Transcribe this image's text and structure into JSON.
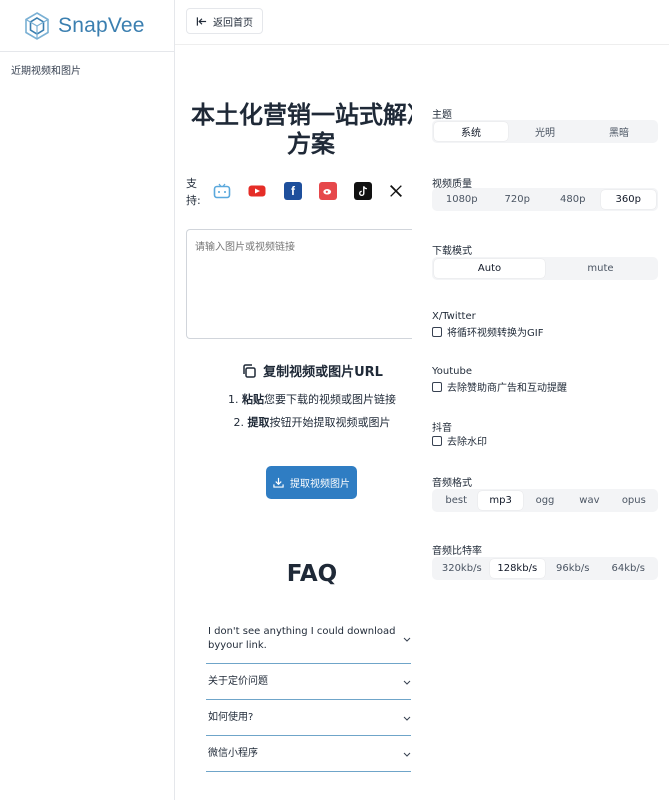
{
  "brand": {
    "name": "SnapVee",
    "color": "#3b7fb0"
  },
  "sidebar": {
    "recent_label": "近期视频和图片"
  },
  "topbar": {
    "back_label": "返回首页"
  },
  "hero": {
    "title": "本土化营销一站式解决方案",
    "support_label": "支持:",
    "platforms": [
      "bilibili-icon",
      "youtube-icon",
      "facebook-icon",
      "weibo-icon",
      "tiktok-icon",
      "x-icon"
    ],
    "input_placeholder": "请输入图片或视频链接",
    "copy_heading": "复制视频或图片URL",
    "steps": [
      {
        "num": "1.",
        "bold": "粘贴",
        "rest": "您要下载的视频或图片链接"
      },
      {
        "num": "2.",
        "bold": "提取",
        "rest": "按钮开始提取视频或图片"
      }
    ],
    "extract_label": "提取视频图片",
    "accent": "#2f7dc3"
  },
  "faq": {
    "title": "FAQ",
    "items": [
      "I don't see anything I could download byyour link.",
      "关于定价问题",
      "如何使用?",
      "微信小程序"
    ]
  },
  "settings": {
    "theme": {
      "label": "主题",
      "options": [
        "系统",
        "光明",
        "黑暗"
      ],
      "selected": "系统"
    },
    "quality": {
      "label": "视频质量",
      "options": [
        "1080p",
        "720p",
        "480p",
        "360p"
      ],
      "selected": "360p"
    },
    "download_mode": {
      "label": "下载模式",
      "options": [
        "Auto",
        "mute"
      ],
      "selected": "Auto"
    },
    "twitter": {
      "label": "X/Twitter",
      "checkbox": "将循环视频转换为GIF"
    },
    "youtube": {
      "label": "Youtube",
      "checkbox": "去除赞助商广告和互动提醒"
    },
    "douyin": {
      "label": "抖音",
      "checkbox": "去除水印"
    },
    "audio_format": {
      "label": "音频格式",
      "options": [
        "best",
        "mp3",
        "ogg",
        "wav",
        "opus"
      ],
      "selected": "mp3"
    },
    "audio_bitrate": {
      "label": "音频比特率",
      "options": [
        "320kb/s",
        "128kb/s",
        "96kb/s",
        "64kb/s"
      ],
      "selected": "128kb/s"
    }
  }
}
